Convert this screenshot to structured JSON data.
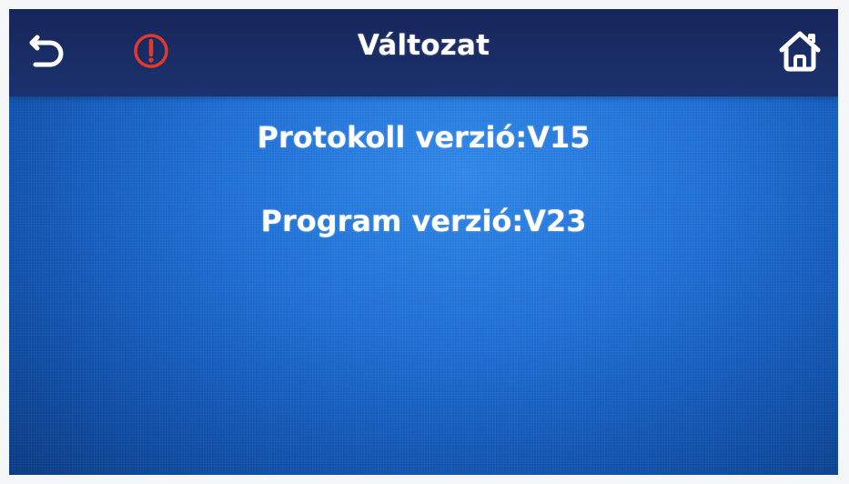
{
  "header": {
    "title": "Változat",
    "back_icon": "back-arrow-icon",
    "alarm_icon": "alarm-exclamation-icon",
    "home_icon": "home-icon"
  },
  "info": {
    "protocol_version": "Protokoll verzió:V15",
    "program_version": "Program verzió:V23"
  },
  "colors": {
    "header_bg": "#1a2d66",
    "body_bg": "#1d6dd3",
    "alarm": "#e03a2f",
    "text": "#ffffff"
  }
}
